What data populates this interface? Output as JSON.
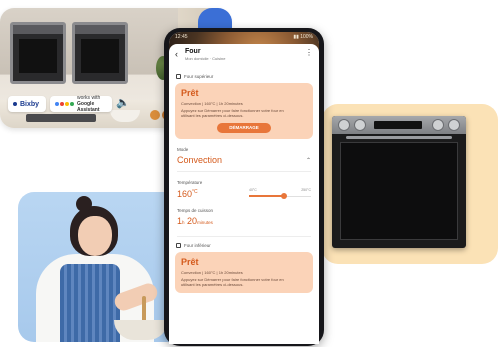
{
  "assistants": {
    "bixby": "Bixby",
    "google_top": "works with",
    "google_bottom": "Google Assistant",
    "speaker_icon": "speaker-icon"
  },
  "phone": {
    "status_time": "12:45",
    "status_right": "▮▮ 100%",
    "appbar": {
      "title": "Four",
      "subtitle": "Mon domicile · Cuisine",
      "back_icon": "back-arrow-icon",
      "more_icon": "more-vert-icon"
    },
    "top_section": {
      "label": "Four supérieur",
      "state": "Prêt",
      "info": "Convection | 160°C | 1h 20minutes",
      "description": "Appuyez sur Démarrer pour faire fonctionner votre four en utilisant les paramètres ci-dessous.",
      "start_button": "DÉMARRAGE"
    },
    "settings": {
      "mode_label": "Mode",
      "mode_value": "Convection",
      "temp_label": "Température",
      "temp_value": "160",
      "temp_unit": "°C",
      "slider_min": "40°C",
      "slider_max": "250°C",
      "slider_level_percent": 57,
      "time_label": "Temps de cuisson",
      "time_hours": "1",
      "time_hours_unit": "h",
      "time_minutes": "20",
      "time_minutes_unit": "minutes"
    },
    "bottom_section": {
      "label": "Four inférieur",
      "state": "Prêt",
      "info": "Convection | 160°C | 1h 20minutes",
      "description": "Appuyez sur Démarrer pour faire fonctionner votre four en utilisant les paramètres ci-dessous."
    }
  },
  "colors": {
    "accent": "#e8763a",
    "accent_text": "#d45a1c",
    "card_bg": "#fbd3b8",
    "oven_backdrop": "#fbe2b6",
    "photo_backdrop": "#a7c9ec"
  }
}
